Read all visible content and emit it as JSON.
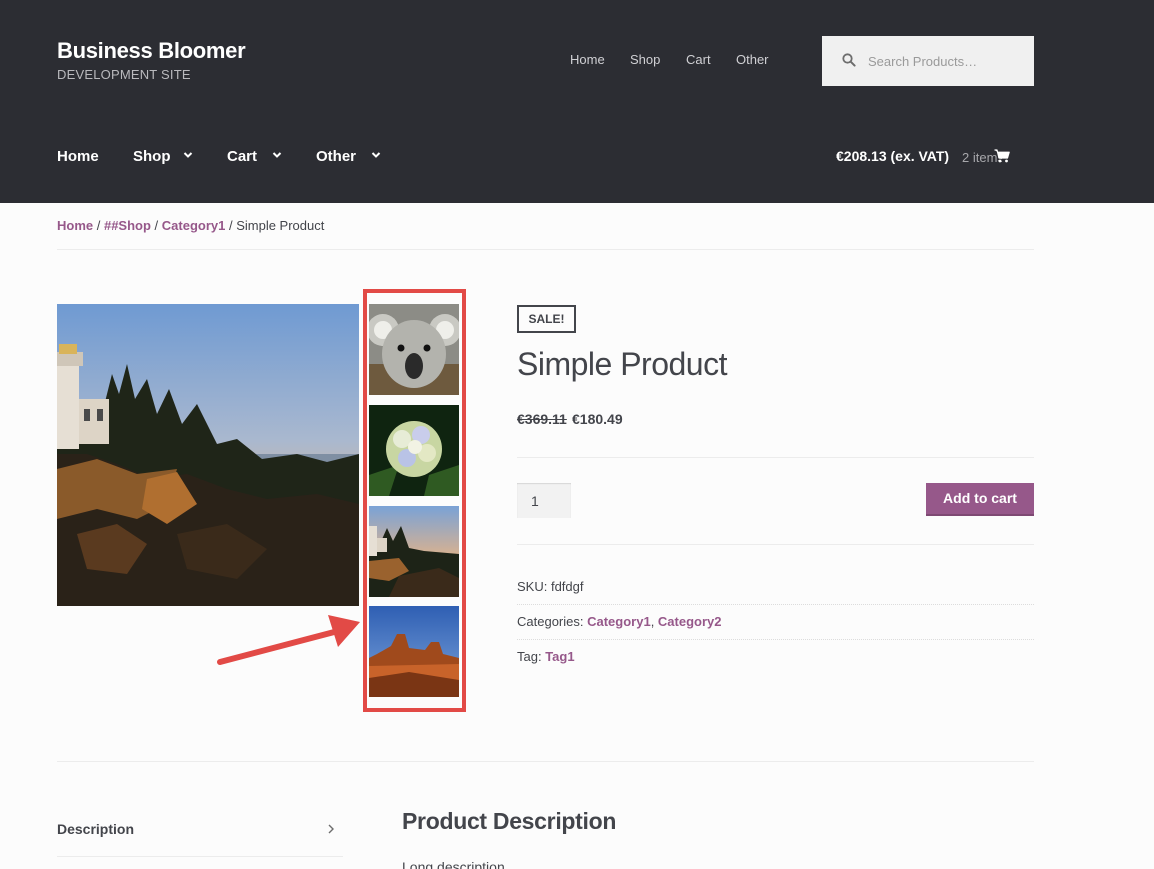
{
  "site": {
    "title": "Business Bloomer",
    "description": "DEVELOPMENT SITE"
  },
  "secondary_nav": [
    {
      "label": "Home"
    },
    {
      "label": "Shop"
    },
    {
      "label": "Cart"
    },
    {
      "label": "Other"
    }
  ],
  "search": {
    "placeholder": "Search Products…"
  },
  "main_nav": [
    {
      "label": "Home"
    },
    {
      "label": "Shop"
    },
    {
      "label": "Cart"
    },
    {
      "label": "Other"
    }
  ],
  "cart": {
    "total": "€208.13 (ex. VAT)",
    "count": "2 items"
  },
  "breadcrumb": {
    "home": "Home",
    "shop": "##Shop",
    "category": "Category1",
    "current": "Simple Product",
    "sep": " / "
  },
  "product": {
    "sale_badge": "SALE!",
    "title": "Simple Product",
    "price_old": "€369.11",
    "price_new": "€180.49",
    "quantity": "1",
    "add_to_cart": "Add to cart",
    "sku_label": "SKU:",
    "sku": "fdfdgf",
    "categories_label": "Categories:",
    "categories": [
      "Category1",
      "Category2"
    ],
    "tag_label": "Tag:",
    "tag": "Tag1"
  },
  "gallery": {
    "main_image": "lighthouse-image",
    "thumbnails": [
      "koala-image",
      "hydrangea-image",
      "lighthouse-image",
      "desert-image"
    ]
  },
  "tabs": {
    "description": "Description"
  },
  "description": {
    "title": "Product Description",
    "body": "Long description"
  },
  "colors": {
    "header_bg": "#2c2d33",
    "accent": "#96588a",
    "highlight": "#e24a46"
  }
}
